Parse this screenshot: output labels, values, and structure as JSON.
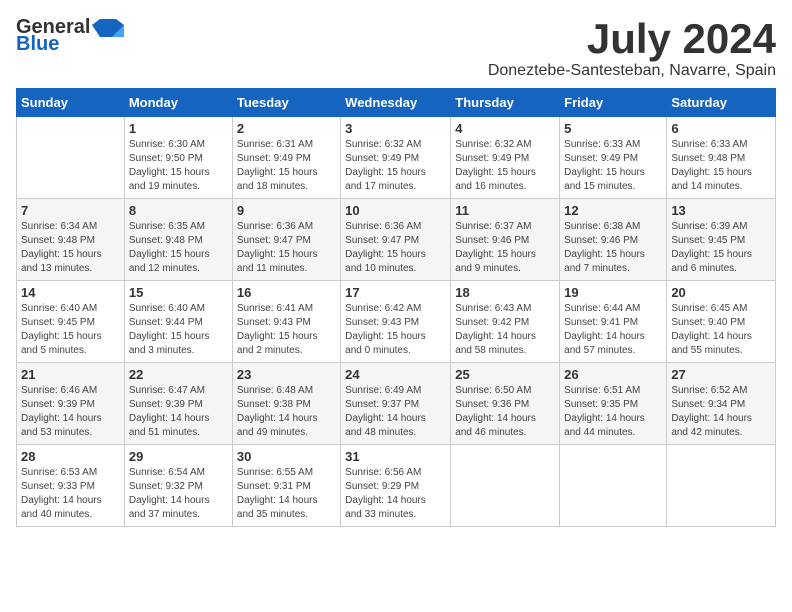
{
  "logo": {
    "general": "General",
    "blue": "Blue"
  },
  "title": {
    "month_year": "July 2024",
    "location": "Doneztebe-Santesteban, Navarre, Spain"
  },
  "days_of_week": [
    "Sunday",
    "Monday",
    "Tuesday",
    "Wednesday",
    "Thursday",
    "Friday",
    "Saturday"
  ],
  "weeks": [
    [
      {
        "day": "",
        "info": ""
      },
      {
        "day": "1",
        "info": "Sunrise: 6:30 AM\nSunset: 9:50 PM\nDaylight: 15 hours\nand 19 minutes."
      },
      {
        "day": "2",
        "info": "Sunrise: 6:31 AM\nSunset: 9:49 PM\nDaylight: 15 hours\nand 18 minutes."
      },
      {
        "day": "3",
        "info": "Sunrise: 6:32 AM\nSunset: 9:49 PM\nDaylight: 15 hours\nand 17 minutes."
      },
      {
        "day": "4",
        "info": "Sunrise: 6:32 AM\nSunset: 9:49 PM\nDaylight: 15 hours\nand 16 minutes."
      },
      {
        "day": "5",
        "info": "Sunrise: 6:33 AM\nSunset: 9:49 PM\nDaylight: 15 hours\nand 15 minutes."
      },
      {
        "day": "6",
        "info": "Sunrise: 6:33 AM\nSunset: 9:48 PM\nDaylight: 15 hours\nand 14 minutes."
      }
    ],
    [
      {
        "day": "7",
        "info": "Sunrise: 6:34 AM\nSunset: 9:48 PM\nDaylight: 15 hours\nand 13 minutes."
      },
      {
        "day": "8",
        "info": "Sunrise: 6:35 AM\nSunset: 9:48 PM\nDaylight: 15 hours\nand 12 minutes."
      },
      {
        "day": "9",
        "info": "Sunrise: 6:36 AM\nSunset: 9:47 PM\nDaylight: 15 hours\nand 11 minutes."
      },
      {
        "day": "10",
        "info": "Sunrise: 6:36 AM\nSunset: 9:47 PM\nDaylight: 15 hours\nand 10 minutes."
      },
      {
        "day": "11",
        "info": "Sunrise: 6:37 AM\nSunset: 9:46 PM\nDaylight: 15 hours\nand 9 minutes."
      },
      {
        "day": "12",
        "info": "Sunrise: 6:38 AM\nSunset: 9:46 PM\nDaylight: 15 hours\nand 7 minutes."
      },
      {
        "day": "13",
        "info": "Sunrise: 6:39 AM\nSunset: 9:45 PM\nDaylight: 15 hours\nand 6 minutes."
      }
    ],
    [
      {
        "day": "14",
        "info": "Sunrise: 6:40 AM\nSunset: 9:45 PM\nDaylight: 15 hours\nand 5 minutes."
      },
      {
        "day": "15",
        "info": "Sunrise: 6:40 AM\nSunset: 9:44 PM\nDaylight: 15 hours\nand 3 minutes."
      },
      {
        "day": "16",
        "info": "Sunrise: 6:41 AM\nSunset: 9:43 PM\nDaylight: 15 hours\nand 2 minutes."
      },
      {
        "day": "17",
        "info": "Sunrise: 6:42 AM\nSunset: 9:43 PM\nDaylight: 15 hours\nand 0 minutes."
      },
      {
        "day": "18",
        "info": "Sunrise: 6:43 AM\nSunset: 9:42 PM\nDaylight: 14 hours\nand 58 minutes."
      },
      {
        "day": "19",
        "info": "Sunrise: 6:44 AM\nSunset: 9:41 PM\nDaylight: 14 hours\nand 57 minutes."
      },
      {
        "day": "20",
        "info": "Sunrise: 6:45 AM\nSunset: 9:40 PM\nDaylight: 14 hours\nand 55 minutes."
      }
    ],
    [
      {
        "day": "21",
        "info": "Sunrise: 6:46 AM\nSunset: 9:39 PM\nDaylight: 14 hours\nand 53 minutes."
      },
      {
        "day": "22",
        "info": "Sunrise: 6:47 AM\nSunset: 9:39 PM\nDaylight: 14 hours\nand 51 minutes."
      },
      {
        "day": "23",
        "info": "Sunrise: 6:48 AM\nSunset: 9:38 PM\nDaylight: 14 hours\nand 49 minutes."
      },
      {
        "day": "24",
        "info": "Sunrise: 6:49 AM\nSunset: 9:37 PM\nDaylight: 14 hours\nand 48 minutes."
      },
      {
        "day": "25",
        "info": "Sunrise: 6:50 AM\nSunset: 9:36 PM\nDaylight: 14 hours\nand 46 minutes."
      },
      {
        "day": "26",
        "info": "Sunrise: 6:51 AM\nSunset: 9:35 PM\nDaylight: 14 hours\nand 44 minutes."
      },
      {
        "day": "27",
        "info": "Sunrise: 6:52 AM\nSunset: 9:34 PM\nDaylight: 14 hours\nand 42 minutes."
      }
    ],
    [
      {
        "day": "28",
        "info": "Sunrise: 6:53 AM\nSunset: 9:33 PM\nDaylight: 14 hours\nand 40 minutes."
      },
      {
        "day": "29",
        "info": "Sunrise: 6:54 AM\nSunset: 9:32 PM\nDaylight: 14 hours\nand 37 minutes."
      },
      {
        "day": "30",
        "info": "Sunrise: 6:55 AM\nSunset: 9:31 PM\nDaylight: 14 hours\nand 35 minutes."
      },
      {
        "day": "31",
        "info": "Sunrise: 6:56 AM\nSunset: 9:29 PM\nDaylight: 14 hours\nand 33 minutes."
      },
      {
        "day": "",
        "info": ""
      },
      {
        "day": "",
        "info": ""
      },
      {
        "day": "",
        "info": ""
      }
    ]
  ]
}
